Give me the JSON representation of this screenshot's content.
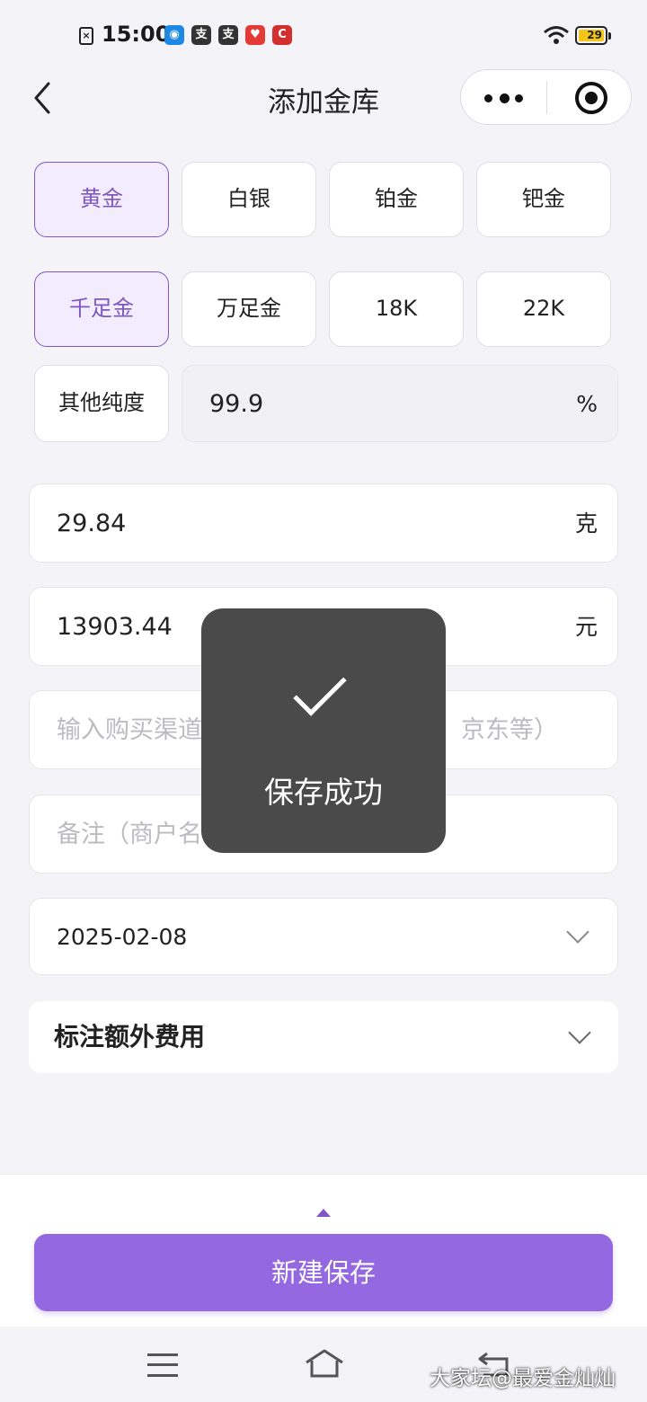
{
  "status_bar": {
    "time": "15:00",
    "battery": "29",
    "icons": [
      "sim-icon",
      "app-icon-blue",
      "app-icon-jie-1",
      "app-icon-jie-2",
      "app-icon-red",
      "app-icon-red-2",
      "wifi-icon",
      "battery-icon"
    ]
  },
  "header": {
    "title": "添加金库",
    "back_icon": "chevron-left-icon",
    "more_icon": "more-dots-icon",
    "close_icon": "target-icon"
  },
  "metals": [
    {
      "label": "黄金",
      "selected": true
    },
    {
      "label": "白银",
      "selected": false
    },
    {
      "label": "铂金",
      "selected": false
    },
    {
      "label": "钯金",
      "selected": false
    }
  ],
  "purities": [
    {
      "label": "千足金",
      "selected": true
    },
    {
      "label": "万足金",
      "selected": false
    },
    {
      "label": "18K",
      "selected": false
    },
    {
      "label": "22K",
      "selected": false
    }
  ],
  "other_purity": {
    "label": "其他纯度",
    "value": "99.9",
    "unit": "%"
  },
  "weight": {
    "value": "29.84",
    "unit": "克"
  },
  "price": {
    "value": "13903.44",
    "unit": "元"
  },
  "channel": {
    "placeholder_left": "输入购买渠道",
    "placeholder_right": "京东等）"
  },
  "note": {
    "placeholder": "备注（商户名"
  },
  "date": {
    "value": "2025-02-08"
  },
  "extra_fees": {
    "label": "标注额外费用"
  },
  "toast": {
    "text": "保存成功",
    "icon": "check-icon"
  },
  "save_button": {
    "label": "新建保存"
  },
  "colors": {
    "accent": "#9468e0",
    "selected_border": "#7e57c2",
    "selected_bg": "#f3ecfc"
  },
  "watermark": "大家坛@最爱金灿灿"
}
